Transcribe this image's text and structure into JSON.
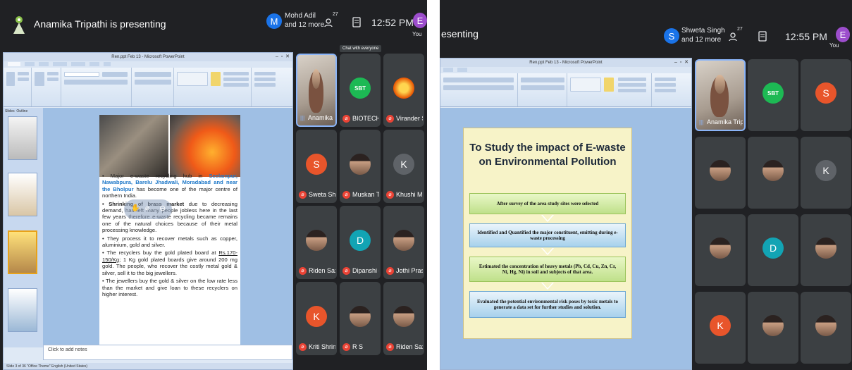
{
  "left": {
    "presenter_text": "Anamika Tripathi is presenting",
    "participants_name": "Mohd Adil",
    "participants_more": "and 12 more",
    "participants_initial": "M",
    "people_count": "27",
    "clock": "12:52 PM",
    "you_initial": "E",
    "you_label": "You",
    "chat_tooltip": "Chat with everyone",
    "ppt_title": "Ren.ppt Feb 13 - Microsoft PowerPoint",
    "ppt_pane_tabs": [
      "Slides",
      "Outline"
    ],
    "slide_text": {
      "p1_lead": "• Major e-waste recycling hub in ",
      "p1_hl": "Seelampur, Nawabpura, Barelu Jhadwali, Moradabad and near the Bholpur",
      "p1_rest": " has become one of the major centre of northern India.",
      "p2_bold": "• Shrinking of brass market",
      "p2_rest": " due to decreasing demand, has left many people jobless here in the last few years therefore e-waste recycling became remains one of the natural choices because of their metal processing knowledge.",
      "p3": "• They process it to recover metals such as copper, aluminium, gold and silver.",
      "p4_lead": "• The recyclers buy the gold plated board at ",
      "p4_under": "Rs.170-150/Kg",
      "p4_rest": "; 1 Kg gold plated boards give around 200 mg gold. The people, who recover the costly metal gold & silver, sell it to the big jewellers.",
      "p5": "• The jewellers buy the gold & silver on the low rate less than the market and give loan to these recyclers on higher interest."
    },
    "notes_placeholder": "Click to add notes",
    "status_text": "Slide 3 of 36   \"Office Theme\"   English (United States)",
    "tiles": [
      {
        "name": "Anamika Trip...",
        "kind": "video"
      },
      {
        "name": "BIOTECH IFT...",
        "initial": "SBT",
        "color": "#1db954"
      },
      {
        "name": "Virander Singh",
        "kind": "logo"
      },
      {
        "name": "Sweta Sharma",
        "initial": "S",
        "color": "#e8552b"
      },
      {
        "name": "Muskan Thak...",
        "kind": "photo"
      },
      {
        "name": "Khushi Mishra",
        "initial": "K",
        "color": "#5f6368"
      },
      {
        "name": "Riden Saxena",
        "kind": "photo"
      },
      {
        "name": "Dipanshi cha...",
        "initial": "D",
        "color": "#12a4b4"
      },
      {
        "name": "Jothi Prasad",
        "kind": "photo"
      },
      {
        "name": "Kriti Shrinet",
        "initial": "K",
        "color": "#e8552b"
      },
      {
        "name": "R S",
        "kind": "photo"
      },
      {
        "name": "Riden Saxena",
        "kind": "photo"
      }
    ]
  },
  "right": {
    "presenter_text": "esenting",
    "participants_name": "Shweta Singh",
    "participants_more": "and 12 more",
    "participants_initial": "S",
    "people_count": "27",
    "clock": "12:55 PM",
    "you_initial": "E",
    "you_label": "You",
    "ppt_title": "Ren.ppt Feb 13 - Microsoft PowerPoint",
    "flow_title": "To Study the impact of E-waste on Environmental Pollution",
    "steps": [
      "After survey of the area study sites were selected",
      "Identified and Quantified the major constituent, emitting during e- waste processing",
      "Estimated the concentration of heavy metals (Pb, Cd, Cu, Zn, Cr, Ni, Hg, Ni) in soil and subjects of that area.",
      "Evaluated the potential environmental risk poses by toxic metals to generate a data set for further studies and solution."
    ],
    "tiles": [
      {
        "name": "Anamika Trip...",
        "kind": "video"
      },
      {
        "initial": "SBT",
        "color": "#1db954"
      },
      {
        "initial": "S",
        "color": "#e8552b"
      },
      {
        "kind": "photo"
      },
      {
        "kind": "photo"
      },
      {
        "initial": "K",
        "color": "#5f6368"
      },
      {
        "kind": "photo"
      },
      {
        "initial": "D",
        "color": "#12a4b4"
      },
      {
        "kind": "photo"
      },
      {
        "initial": "K",
        "color": "#e8552b"
      },
      {
        "kind": "photo"
      },
      {
        "kind": "photo"
      }
    ]
  }
}
